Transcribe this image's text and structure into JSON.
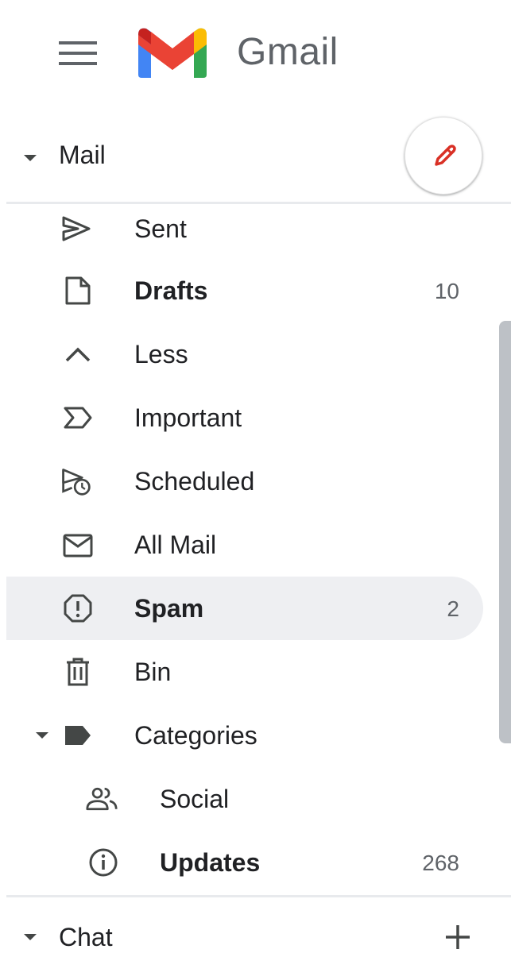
{
  "app": {
    "name": "Gmail"
  },
  "mail_section": {
    "label": "Mail",
    "compose_icon": "pencil-icon"
  },
  "nav_items": [
    {
      "label": "Sent",
      "icon": "sent-icon",
      "count": "",
      "bold": false
    },
    {
      "label": "Drafts",
      "icon": "drafts-icon",
      "count": "10",
      "bold": true
    },
    {
      "label": "Less",
      "icon": "chevron-up-icon",
      "count": "",
      "bold": false
    },
    {
      "label": "Important",
      "icon": "important-icon",
      "count": "",
      "bold": false
    },
    {
      "label": "Scheduled",
      "icon": "scheduled-icon",
      "count": "",
      "bold": false
    },
    {
      "label": "All Mail",
      "icon": "all-mail-icon",
      "count": "",
      "bold": false
    },
    {
      "label": "Spam",
      "icon": "spam-icon",
      "count": "2",
      "bold": true,
      "active": true
    },
    {
      "label": "Bin",
      "icon": "bin-icon",
      "count": "",
      "bold": false
    },
    {
      "label": "Categories",
      "icon": "label-icon",
      "count": "",
      "bold": false
    },
    {
      "label": "Social",
      "icon": "social-icon",
      "count": "",
      "bold": false
    },
    {
      "label": "Updates",
      "icon": "info-icon",
      "count": "268",
      "bold": true
    }
  ],
  "chat_section": {
    "label": "Chat",
    "add_icon": "plus-icon"
  },
  "colors": {
    "active_row": "#eeeff2",
    "compose_pencil": "#d93025",
    "text": "#202124",
    "icon": "#444746"
  }
}
